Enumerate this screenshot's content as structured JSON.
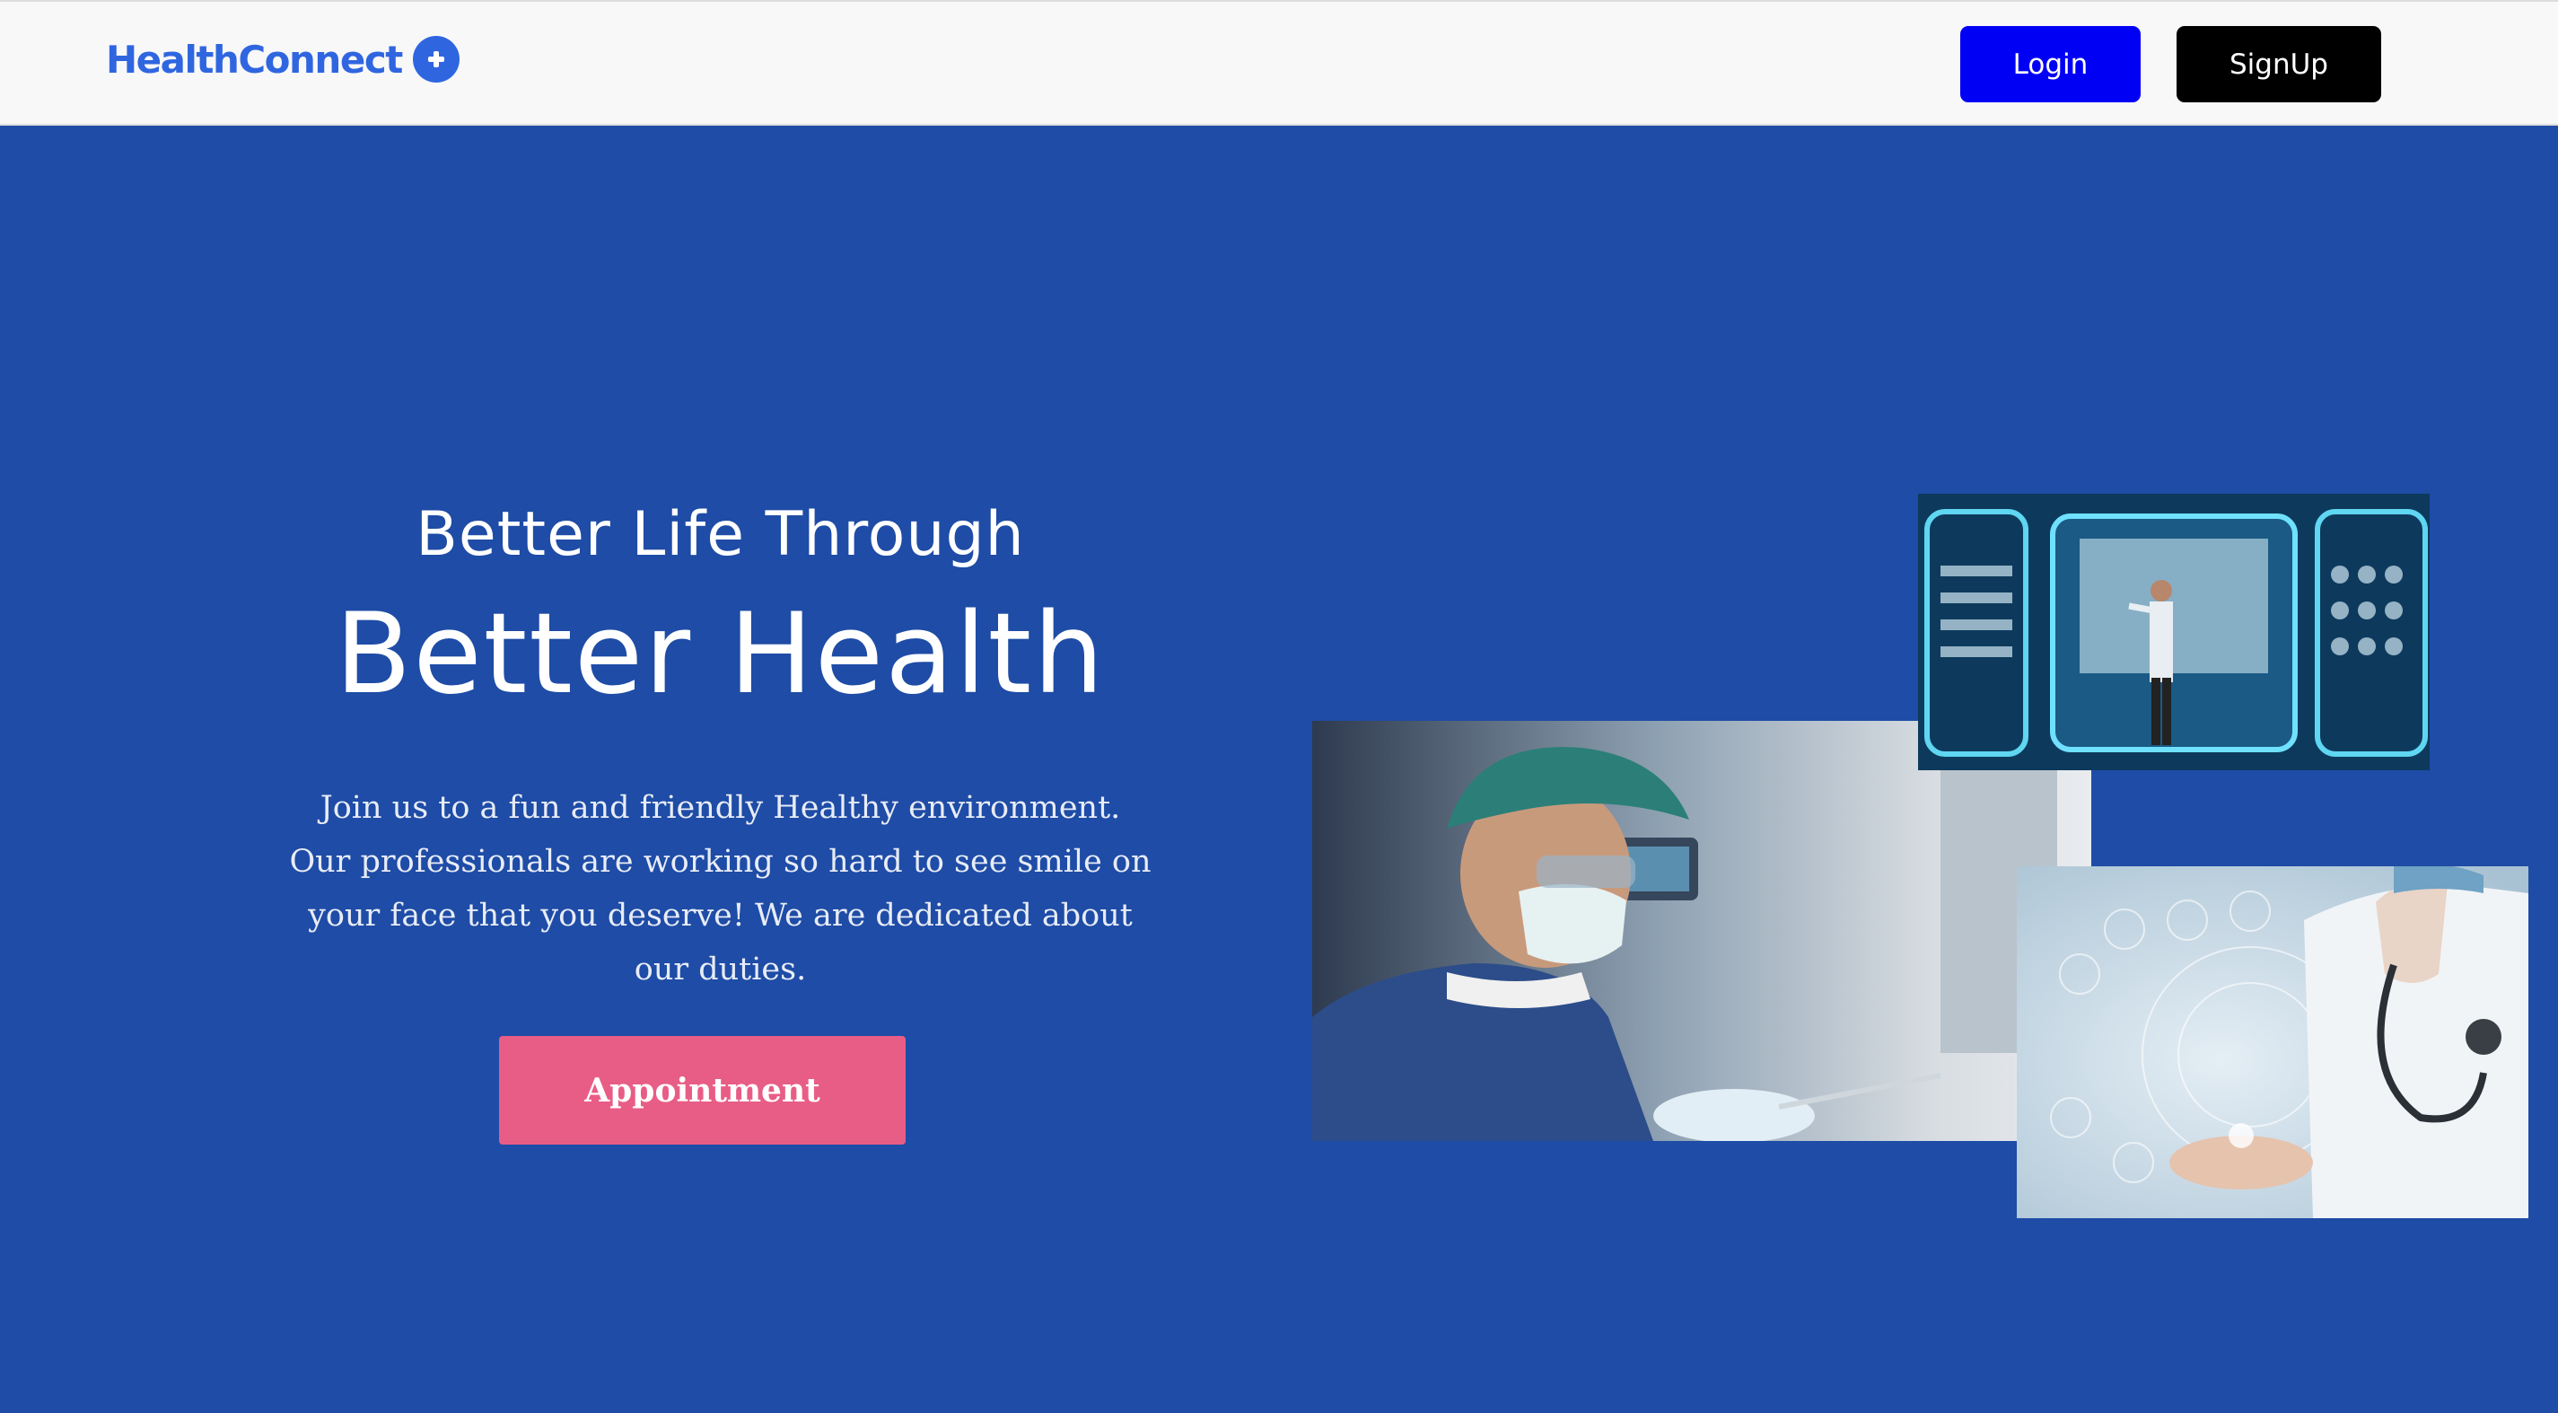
{
  "navbar": {
    "logo_text": "HealthConnect",
    "logo_icon": "plus-circle-icon",
    "login_label": "Login",
    "signup_label": "SignUp"
  },
  "hero": {
    "subheading": "Better Life Through",
    "heading": "Better Health",
    "description": "Join us to a fun and friendly Healthy environment. Our professionals are working so hard to see smile on your face that you deserve! We are dedicated about our duties.",
    "cta_label": "Appointment"
  },
  "images": {
    "surgeon": "surgeon-with-mask-photo",
    "hologram": "doctor-hologram-screens-photo",
    "doctor": "doctor-stethoscope-digital-icons-photo"
  },
  "colors": {
    "hero_background": "#1e4ca6",
    "logo": "#2f66e0",
    "login_button": "#0000f5",
    "signup_button": "#000000",
    "appointment_button": "#e85d86"
  }
}
